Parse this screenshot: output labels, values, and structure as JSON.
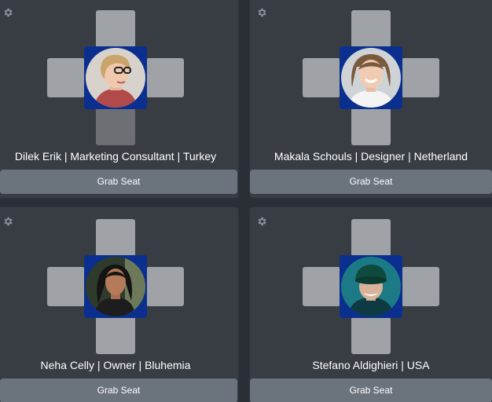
{
  "grab_label": "Grab Seat",
  "colors": {
    "background": "#2a2f36",
    "card": "#383d44",
    "seat": "#9fa2a6",
    "seat_occupied_marker": "#6c6f73",
    "center_frame": "#0a2f8f",
    "grab_button": "#6b737d"
  },
  "tables": [
    {
      "participant": "Dilek Erik | Marketing Consultant | Turkey",
      "icon": "gear-icon"
    },
    {
      "participant": "Makala Schouls | Designer | Netherland",
      "icon": "gear-icon"
    },
    {
      "participant": "Neha Celly | Owner | Bluhemia",
      "icon": "gear-icon"
    },
    {
      "participant": "Stefano Aldighieri | USA",
      "icon": "gear-icon"
    }
  ]
}
